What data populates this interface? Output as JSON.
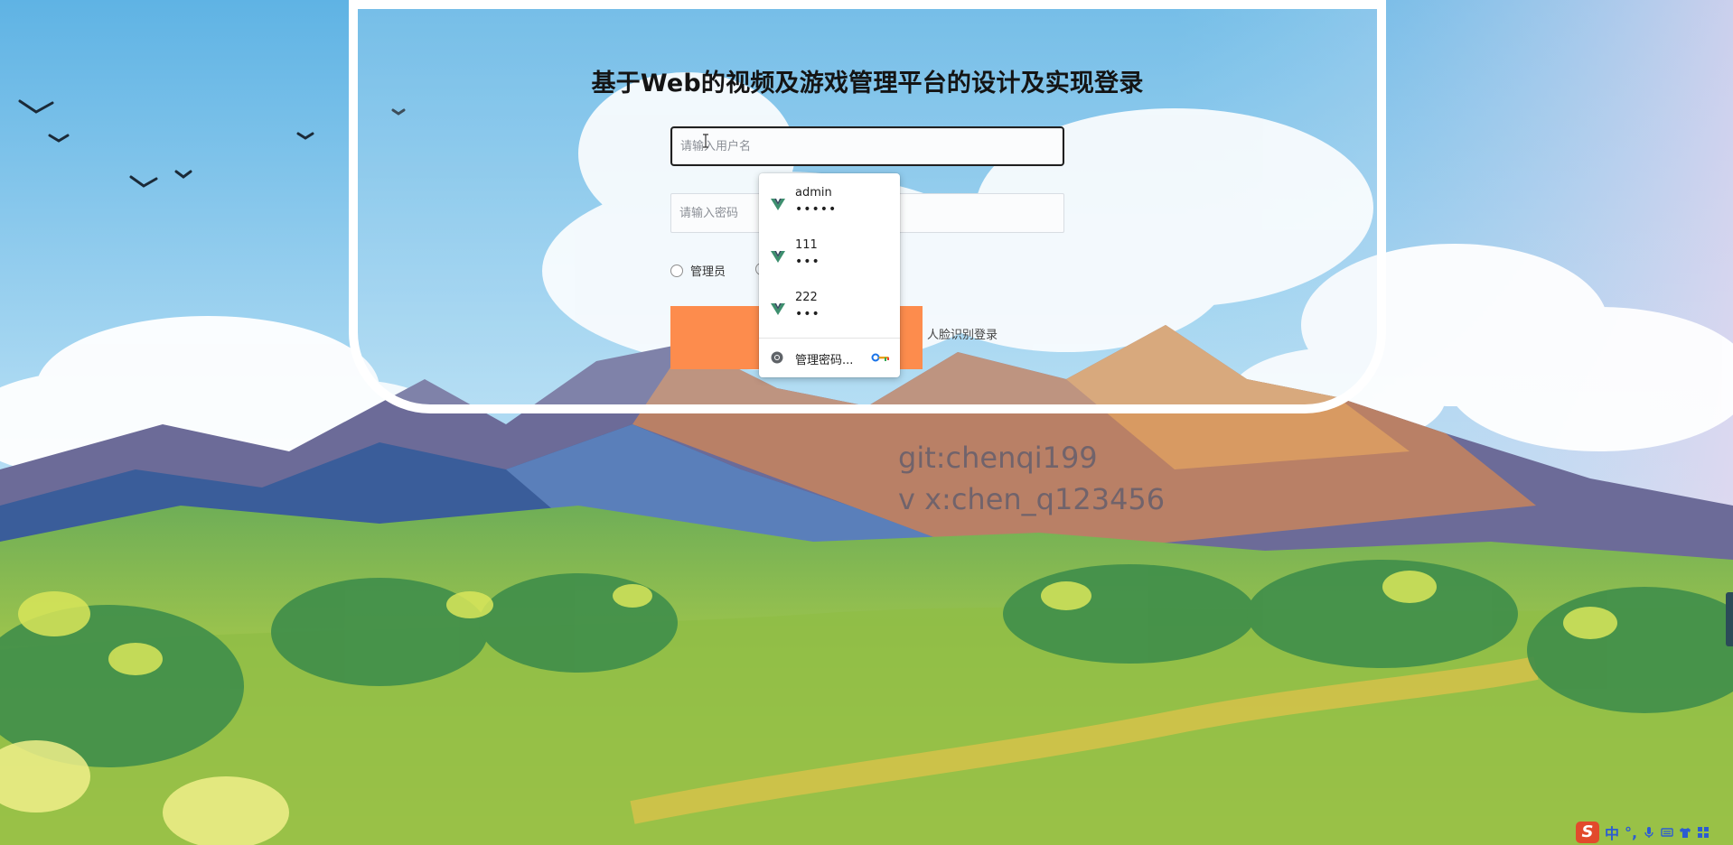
{
  "page": {
    "title": "基于Web的视频及游戏管理平台的设计及实现登录"
  },
  "form": {
    "username_placeholder": "请输入用户名",
    "password_placeholder": "请输入密码",
    "role_admin_label": "管理员",
    "login_button_label": "",
    "face_login_label": "人脸识别登录"
  },
  "autofill": {
    "suggestions": [
      {
        "username": "admin",
        "password_mask": "•••••"
      },
      {
        "username": "111",
        "password_mask": "•••"
      },
      {
        "username": "222",
        "password_mask": "•••"
      }
    ],
    "manage_label": "管理密码..."
  },
  "watermark": {
    "line1": "git:chenqi199",
    "line2": "v x:chen_q123456"
  },
  "ime": {
    "mode_label": "中",
    "punct_label": "°,"
  },
  "colors": {
    "login_button": "#fd8c4d",
    "vue_icon": "#3d8f6e",
    "ime_logo": "#e24a2c"
  }
}
